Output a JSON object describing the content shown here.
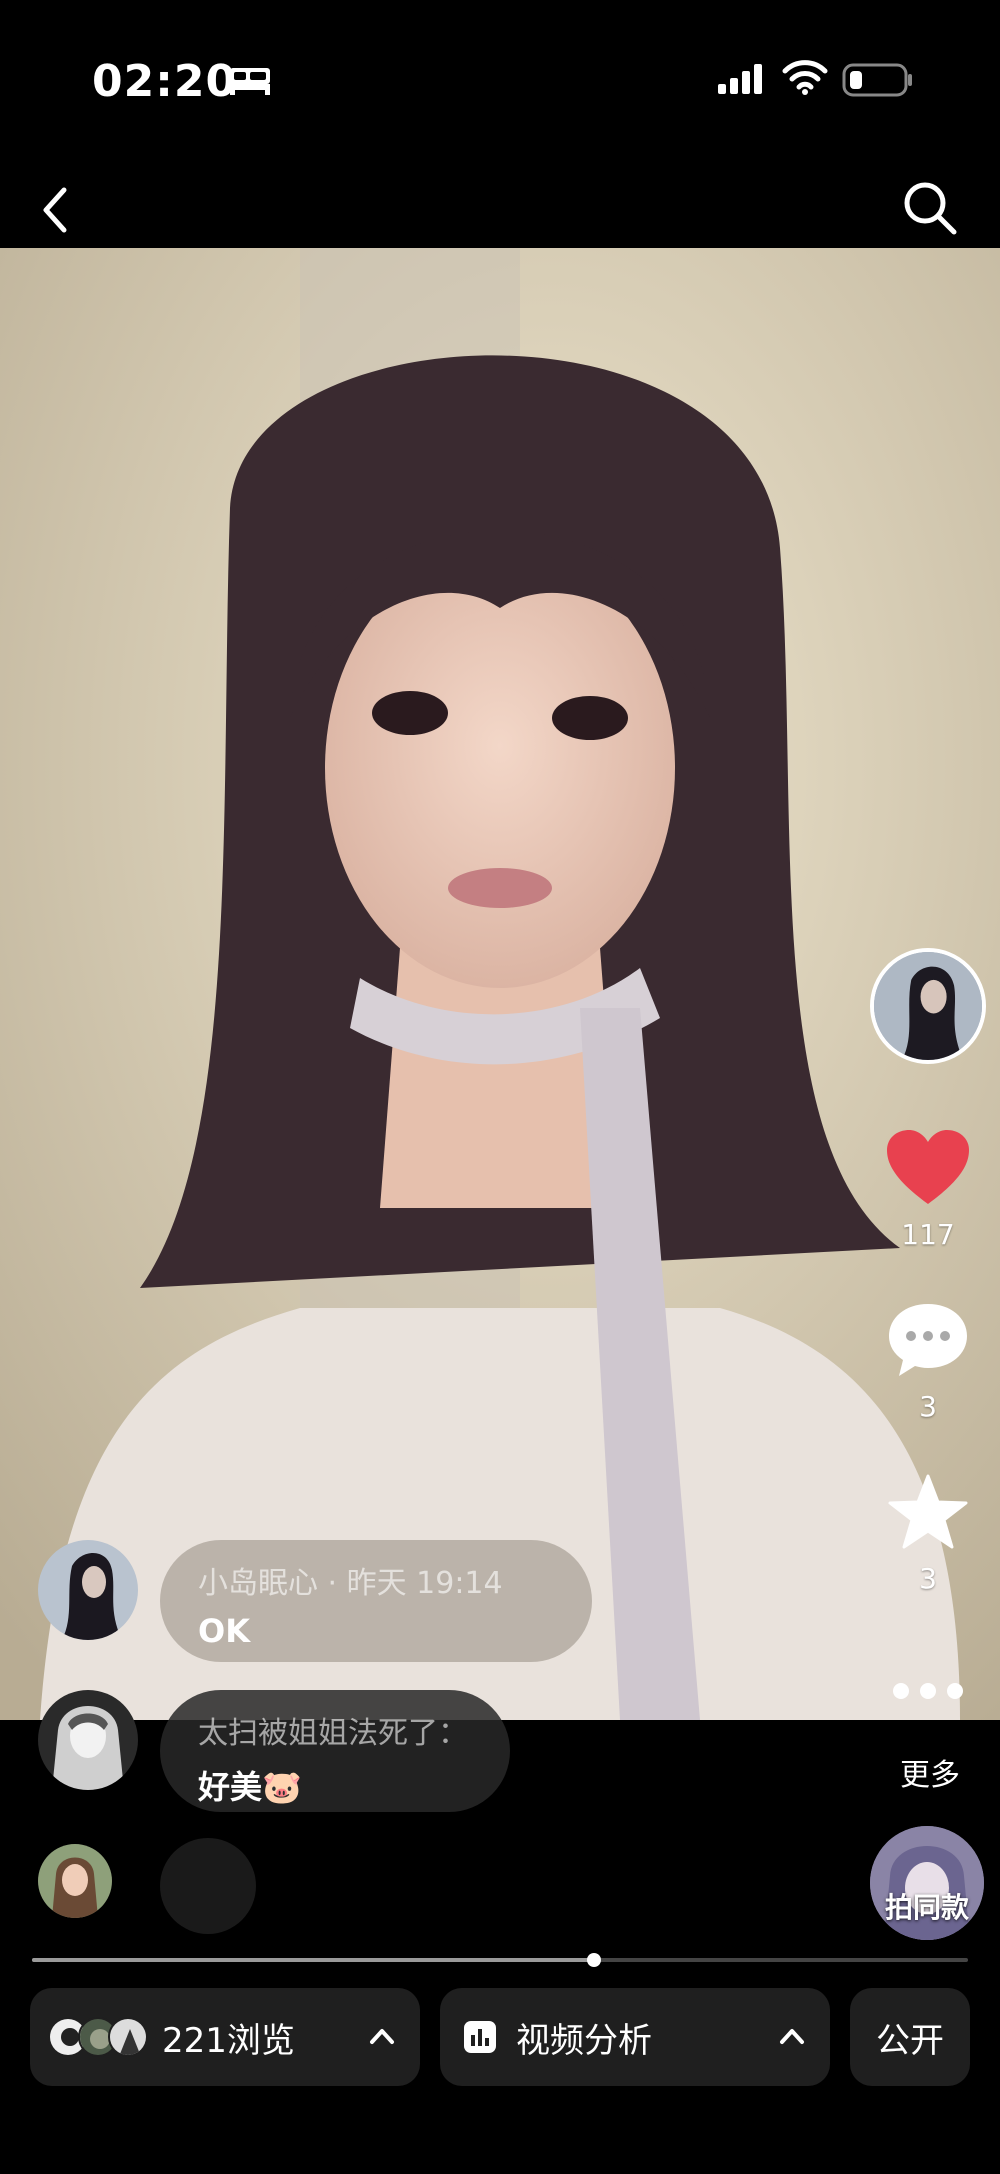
{
  "status_bar": {
    "time": "02:20"
  },
  "creator": {
    "avatar_icon": "creator-avatar"
  },
  "actions": {
    "like_count": "117",
    "comment_count": "3",
    "favorite_count": "3",
    "more_label": "更多"
  },
  "comments": [
    {
      "meta": "小岛眠心 · 昨天 19:14",
      "text": "OK"
    },
    {
      "meta": "太扫被姐姐法死了：",
      "text": "好美🐷"
    }
  ],
  "same_style_label": "拍同款",
  "progress": {
    "fraction": 0.6
  },
  "bottom_bar": {
    "views_label": "221浏览",
    "analysis_label": "视频分析",
    "public_label": "公开"
  },
  "colors": {
    "like": "#e8414f",
    "background": "#000000",
    "pill": "#1f1f1f"
  }
}
